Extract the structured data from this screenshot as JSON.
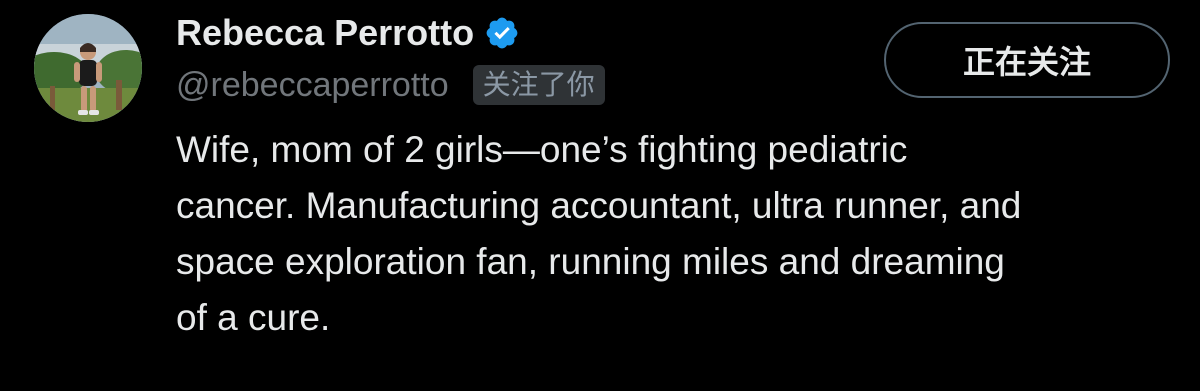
{
  "user": {
    "display_name": "Rebecca Perrotto",
    "verified_icon": "verified-badge-icon",
    "handle": "@rebeccaperrotto",
    "follows_you_badge": "关注了你",
    "follow_button_label": "正在关注",
    "bio_lines": [
      "Wife, mom of 2 girls—one’s fighting pediatric",
      "cancer. Manufacturing accountant, ultra runner, and",
      "space exploration fan, running miles and dreaming",
      "of a cure."
    ]
  },
  "colors": {
    "background": "#000000",
    "primary_text": "#e7e9ea",
    "secondary_text": "#71767b",
    "verified_blue": "#1d9bf0",
    "badge_background": "#2f3336",
    "button_border": "#536471"
  }
}
